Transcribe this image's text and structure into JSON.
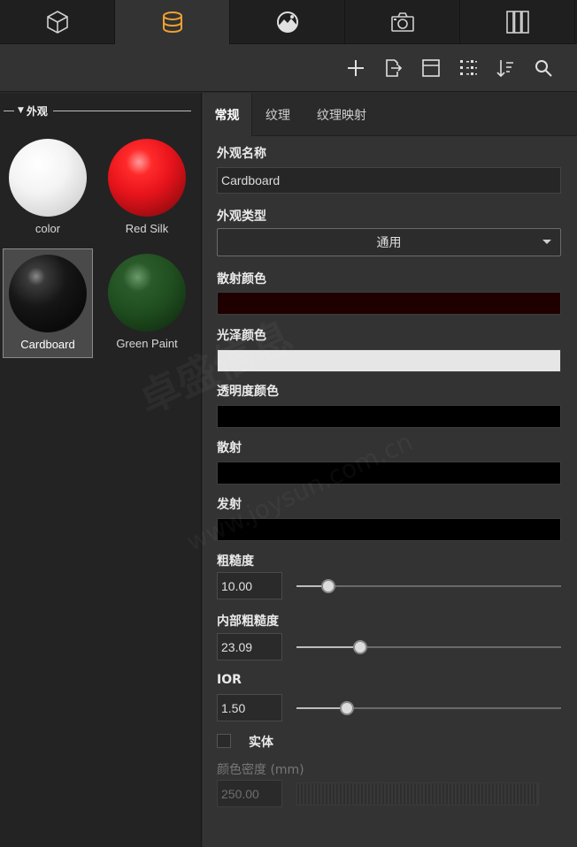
{
  "top_tabs": [
    {
      "icon": "cube-icon"
    },
    {
      "icon": "database-icon",
      "active": true
    },
    {
      "icon": "environment-icon"
    },
    {
      "icon": "camera-icon"
    },
    {
      "icon": "bars-icon"
    }
  ],
  "toolbar": {
    "icons": [
      "add-icon",
      "export-icon",
      "layout-icon",
      "grid-view-icon",
      "sort-icon",
      "search-icon"
    ]
  },
  "library": {
    "section_title": "外观",
    "materials": [
      {
        "label": "color",
        "color": "#ffffff"
      },
      {
        "label": "Red Silk",
        "color": "#e8141c"
      },
      {
        "label": "Cardboard",
        "color": "#0c0c0c",
        "selected": true
      },
      {
        "label": "Green Paint",
        "color": "#1f4d1f"
      }
    ]
  },
  "tabs": [
    {
      "label": "常规",
      "active": true
    },
    {
      "label": "纹理"
    },
    {
      "label": "纹理映射"
    }
  ],
  "properties": {
    "name_label": "外观名称",
    "name_value": "Cardboard",
    "type_label": "外观类型",
    "type_value": "通用",
    "diffuse_label": "散射颜色",
    "diffuse_color": "#1e0000",
    "specular_label": "光泽颜色",
    "specular_color": "#e6e6e6",
    "transparency_label": "透明度颜色",
    "transparency_color": "#000000",
    "scatter_label": "散射",
    "scatter_color": "#000000",
    "emission_label": "发射",
    "emission_color": "#000000",
    "roughness_label": "粗糙度",
    "roughness_value": "10.00",
    "roughness_level": 0.12,
    "inner_roughness_label": "内部粗糙度",
    "inner_roughness_value": "23.09",
    "inner_roughness_level": 0.24,
    "ior_label": "IOR",
    "ior_value": "1.50",
    "ior_level": 0.19,
    "solid_label": "实体",
    "solid_checked": false,
    "density_label": "颜色密度 (mm)",
    "density_value": "250.00"
  },
  "watermark": {
    "line1": "卓盛信息",
    "line2": "www.joysun.com.cn"
  }
}
